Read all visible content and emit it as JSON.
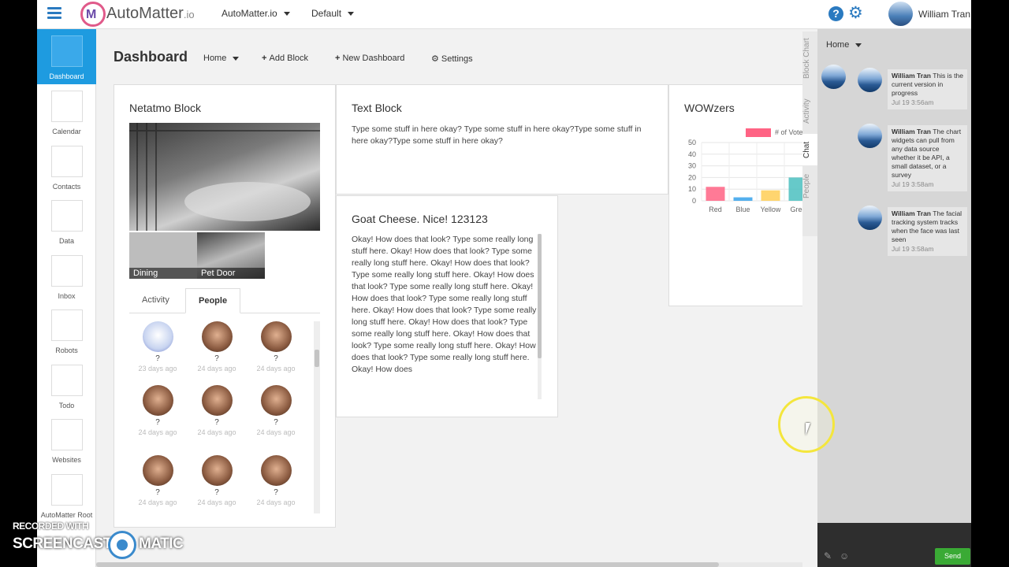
{
  "topbar": {
    "logo_text": "AutoMatter",
    "logo_suffix": ".io",
    "org_dropdown": "AutoMatter.io",
    "view_dropdown": "Default",
    "user_name": "William Tran"
  },
  "nav": {
    "items": [
      {
        "label": "Dashboard"
      },
      {
        "label": "Calendar"
      },
      {
        "label": "Contacts"
      },
      {
        "label": "Data"
      },
      {
        "label": "Inbox"
      },
      {
        "label": "Robots"
      },
      {
        "label": "Todo"
      },
      {
        "label": "Websites"
      },
      {
        "label": "AutoMatter Root"
      }
    ]
  },
  "dashboard": {
    "title": "Dashboard",
    "home_dropdown": "Home",
    "add_block": "Add Block",
    "new_dashboard": "New Dashboard",
    "settings": "Settings"
  },
  "netatmo": {
    "title": "Netatmo Block",
    "thumbs": [
      "Dining",
      "Pet Door"
    ],
    "tabs": [
      "Activity",
      "People"
    ],
    "active_tab": "People",
    "people": [
      {
        "name": "?",
        "ago": "23 days ago"
      },
      {
        "name": "?",
        "ago": "24 days ago"
      },
      {
        "name": "?",
        "ago": "24 days ago"
      },
      {
        "name": "?",
        "ago": "24 days ago"
      },
      {
        "name": "?",
        "ago": "24 days ago"
      },
      {
        "name": "?",
        "ago": "24 days ago"
      },
      {
        "name": "?",
        "ago": "24 days ago"
      },
      {
        "name": "?",
        "ago": "24 days ago"
      },
      {
        "name": "?",
        "ago": "24 days ago"
      }
    ]
  },
  "text_block": {
    "title": "Text Block",
    "body": "Type some stuff in here okay? Type some stuff in here okay?Type some stuff in here okay?Type some stuff in here okay?"
  },
  "goat_block": {
    "title": "Goat Cheese. Nice! 123123",
    "body": "Okay! How does that look? Type some really long stuff here. Okay! How does that look? Type some really long stuff here. Okay! How does that look? Type some really long stuff here. Okay! How does that look? Type some really long stuff here. Okay! How does that look? Type some really long stuff here. Okay! How does that look? Type some really long stuff here. Okay! How does that look? Type some really long stuff here. Okay! How does that look? Type some really long stuff here. Okay! How does that look? Type some really long stuff here. Okay! How does"
  },
  "chart_data": {
    "type": "bar",
    "title": "WOWzers",
    "categories": [
      "Red",
      "Blue",
      "Yellow",
      "Gree"
    ],
    "series": [
      {
        "name": "# of Vote",
        "values": [
          12,
          3,
          9,
          20
        ]
      }
    ],
    "colors": [
      "#ff6384",
      "#36a2eb",
      "#ffce56",
      "#4bc0c0"
    ],
    "yticks": [
      0,
      10,
      20,
      30,
      40,
      50
    ],
    "ylim": [
      0,
      50
    ],
    "legend": "top"
  },
  "side_tabs": [
    "Block Chart",
    "Activity",
    "Chat",
    "People"
  ],
  "chat": {
    "header": "Home",
    "messages": [
      {
        "author": "William Tran",
        "text": "This is the current version in progress",
        "time": "Jul 19 3:56am"
      },
      {
        "author": "William Tran",
        "text": "The chart widgets can pull from any data source whether it be API, a small dataset, or a survey",
        "time": "Jul 19 3:58am"
      },
      {
        "author": "William Tran",
        "text": "The facial tracking system tracks when the face was last seen",
        "time": "Jul 19 3:58am"
      }
    ],
    "send_label": "Send"
  },
  "watermark": {
    "line1": "RECORDED WITH",
    "line2a": "SCREENCAST",
    "line2b": "MATIC"
  }
}
